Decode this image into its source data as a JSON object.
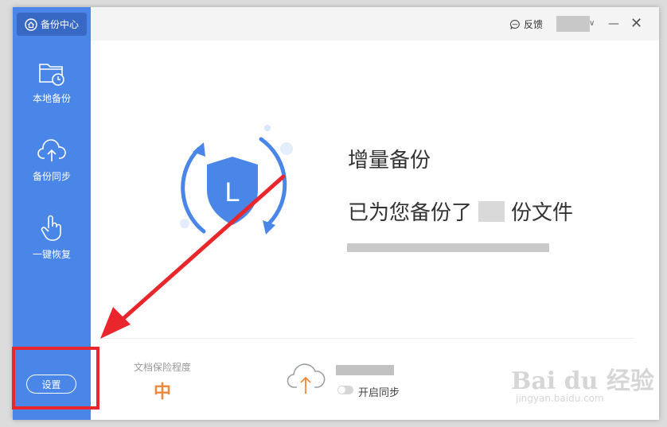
{
  "sidebar": {
    "brand": "备份中心",
    "items": [
      {
        "label": "本地备份",
        "icon": "folder-clock-icon"
      },
      {
        "label": "备份同步",
        "icon": "cloud-upload-icon"
      },
      {
        "label": "一键恢复",
        "icon": "hand-pointer-icon"
      }
    ],
    "settings_label": "设置"
  },
  "topbar": {
    "feedback_label": "反馈",
    "minimize_glyph": "—",
    "close_glyph": "✕",
    "chevron_glyph": "∨"
  },
  "hero": {
    "title": "增量备份",
    "subtitle_prefix": "已为您备份了",
    "subtitle_suffix": "份文件",
    "shield_letter": "L"
  },
  "footer": {
    "protection_label": "文档保险程度",
    "protection_value": "中",
    "sync_label": "开启同步"
  },
  "watermark": {
    "text": "Bai du 经验",
    "url": "jingyan.baidu.com"
  },
  "colors": {
    "sidebar": "#4a86e8",
    "brand_bg": "#3668c4",
    "accent_orange": "#f0883a",
    "annotation_red": "#e8262b"
  }
}
